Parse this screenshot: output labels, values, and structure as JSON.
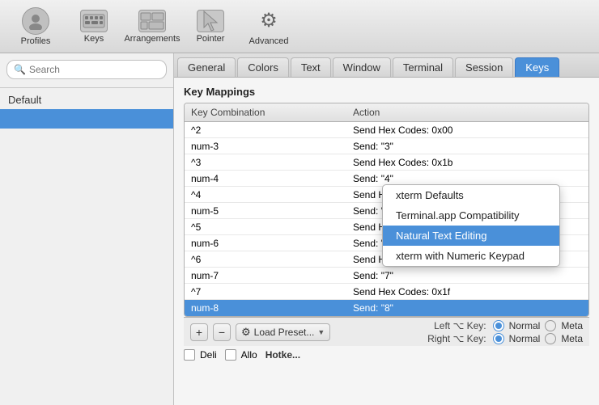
{
  "toolbar": {
    "items": [
      {
        "id": "profiles",
        "label": "Profiles",
        "icon": "person"
      },
      {
        "id": "keys",
        "label": "Keys",
        "icon": "keyboard"
      },
      {
        "id": "arrangements",
        "label": "Arrangements",
        "icon": "grid"
      },
      {
        "id": "pointer",
        "label": "Pointer",
        "icon": "cursor"
      },
      {
        "id": "advanced",
        "label": "Advanced",
        "icon": "gear"
      }
    ]
  },
  "sidebar": {
    "search_placeholder": "Search",
    "items": [
      {
        "label": "Default",
        "selected": false
      },
      {
        "label": "",
        "selected": true
      }
    ]
  },
  "tabs": [
    {
      "label": "General",
      "active": false
    },
    {
      "label": "Colors",
      "active": false
    },
    {
      "label": "Text",
      "active": false
    },
    {
      "label": "Window",
      "active": false
    },
    {
      "label": "Terminal",
      "active": false
    },
    {
      "label": "Session",
      "active": false
    },
    {
      "label": "Keys",
      "active": true
    }
  ],
  "keys_section": {
    "title": "Key Mappings",
    "table": {
      "headers": [
        "Key Combination",
        "Action"
      ],
      "rows": [
        {
          "key": "^2",
          "action": "Send Hex Codes: 0x00",
          "selected": false
        },
        {
          "key": "num-3",
          "action": "Send: \"3\"",
          "selected": false
        },
        {
          "key": "^3",
          "action": "Send Hex Codes: 0x1b",
          "selected": false
        },
        {
          "key": "num-4",
          "action": "Send: \"4\"",
          "selected": false
        },
        {
          "key": "^4",
          "action": "Send Hex Codes: 0x1c",
          "selected": false
        },
        {
          "key": "num-5",
          "action": "Send: \"5\"",
          "selected": false
        },
        {
          "key": "^5",
          "action": "Send Hex Codes: 0x1d",
          "selected": false
        },
        {
          "key": "num-6",
          "action": "Send: \"6\"",
          "selected": false
        },
        {
          "key": "^6",
          "action": "Send Hex Codes: 0x1e",
          "selected": false
        },
        {
          "key": "num-7",
          "action": "Send: \"7\"",
          "selected": false
        },
        {
          "key": "^7",
          "action": "Send Hex Codes: 0x1f",
          "selected": false
        },
        {
          "key": "num-8",
          "action": "Send: \"8\"",
          "selected": true
        }
      ]
    }
  },
  "bottom_bar": {
    "add_label": "+",
    "remove_label": "−",
    "load_preset_label": "Load Preset...",
    "dropdown": {
      "items": [
        {
          "label": "xterm Defaults",
          "highlighted": false
        },
        {
          "label": "Terminal.app Compatibility",
          "highlighted": false
        },
        {
          "label": "Natural Text Editing",
          "highlighted": true
        },
        {
          "label": "xterm with Numeric Keypad",
          "highlighted": false
        }
      ]
    }
  },
  "right_options": {
    "left_key_label": "Left ⌥ Key:",
    "right_key_label": "Right ⌥ Key:",
    "options": [
      "Normal",
      "Meta"
    ],
    "left_selected": "Normal",
    "right_selected": "Normal"
  },
  "checkbox_rows": [
    {
      "label": "Deli"
    },
    {
      "label": "Allo"
    }
  ],
  "hotkey_label": "Hotke..."
}
